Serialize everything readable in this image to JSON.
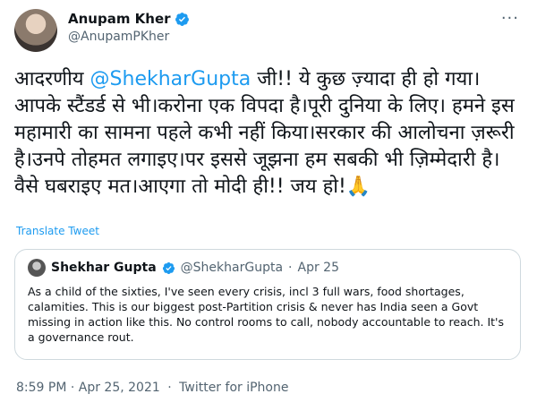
{
  "tweet": {
    "author_name": "Anupam Kher",
    "author_handle": "@AnupamPKher",
    "more_icon": "···",
    "text_part1": "आदरणीय ",
    "mention": "@ShekharGupta",
    "text_part2": " जी!! ये कुछ ज़्यादा ही हो गया। आपके स्टैंडर्ड से भी।करोना एक विपदा है।पूरी दुनिया के लिए। हमने इस महामारी का सामना पहले कभी नहीं किया।सरकार की आलोचना ज़रूरी है।उनपे तोहमत लगाइए।पर इससे जूझना हम सबकी भी ज़िम्मेदारी है।वैसे घबराइए मत।आएगा तो मोदी ही!! जय हो!🙏",
    "translate_label": "Translate Tweet",
    "timestamp": "8:59 PM · Apr 25, 2021",
    "source": "Twitter for iPhone"
  },
  "quote": {
    "name": "Shekhar Gupta",
    "handle": "@ShekharGupta",
    "dot": "·",
    "date": "Apr 25",
    "text": "As a child of the sixties, I've seen every crisis, incl 3 full wars, food shortages, calamities. This is our biggest post-Partition crisis & never has India seen a Govt missing in action like this. No control rooms to call, nobody accountable to reach. It's a governance rout."
  },
  "colors": {
    "accent": "#1d9bf0",
    "muted": "#536471",
    "border": "#cfd9de"
  }
}
